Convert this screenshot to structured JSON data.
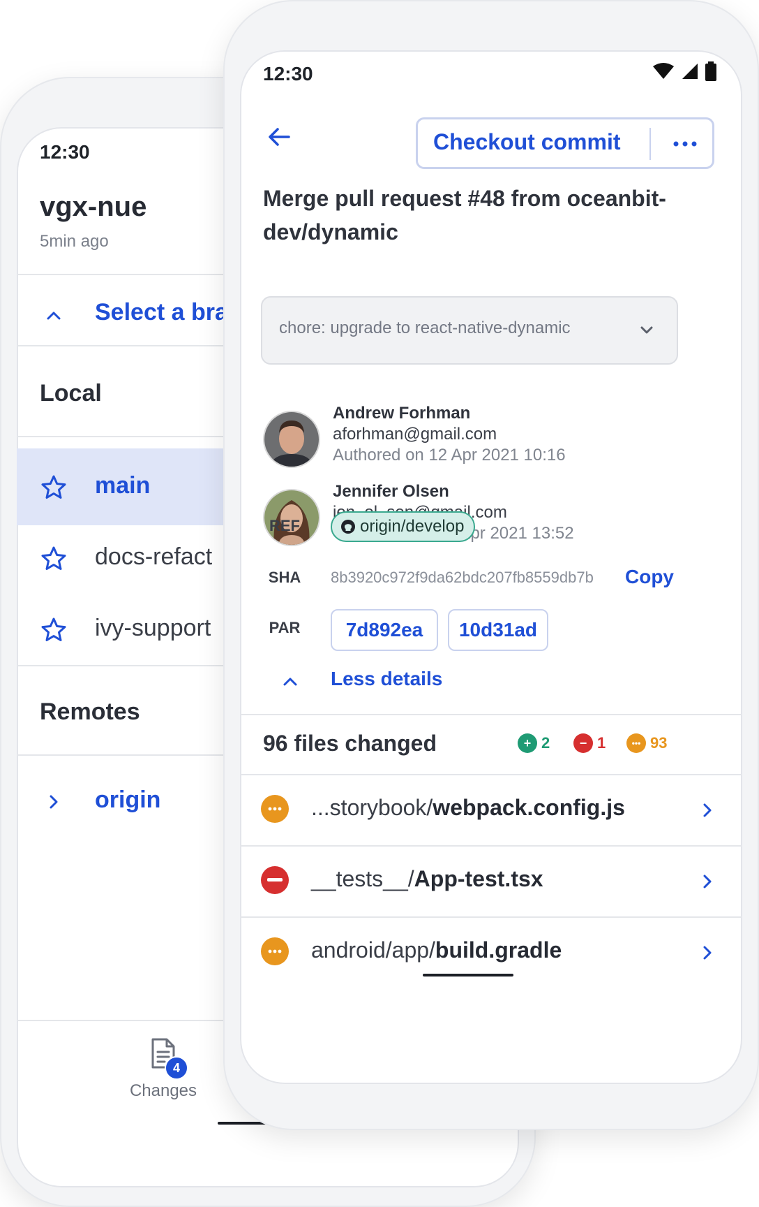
{
  "back_screen": {
    "time": "12:30",
    "repo_name": "vgx-nue",
    "repo_updated": "5min ago",
    "select_branch_label": "Select a bra",
    "local_title": "Local",
    "branches": [
      {
        "name": "main",
        "selected": true
      },
      {
        "name": "docs-refact",
        "selected": false
      },
      {
        "name": "ivy-support",
        "selected": false
      }
    ],
    "remotes_title": "Remotes",
    "remotes": [
      {
        "name": "origin"
      }
    ],
    "tab": {
      "label": "Changes",
      "badge": "4"
    }
  },
  "front_screen": {
    "time": "12:30",
    "checkout_label": "Checkout commit",
    "commit_title": "Merge pull request #48 from oceanbit-dev/dynamic",
    "commit_message_selected": "chore: upgrade to react-native-dynamic",
    "author": {
      "name": "Andrew Forhman",
      "email": "aforhman@gmail.com",
      "date": "Authored on 12 Apr 2021 10:16"
    },
    "committer": {
      "name": "Jennifer Olsen",
      "email": "jen_ol_sen@gmail.com",
      "date": "Commited on 16 Apr 2021 13:52"
    },
    "ref_label": "REF",
    "ref_value": "origin/develop",
    "sha_label": "SHA",
    "sha_value": "8b3920c972f9da62bdc207fb8559db7b",
    "copy_label": "Copy",
    "par_label": "PAR",
    "parents": [
      "7d892ea",
      "10d31ad"
    ],
    "less_details_label": "Less details",
    "files_changed_label": "96 files changed",
    "stats": {
      "added": "2",
      "removed": "1",
      "modified": "93"
    },
    "files": [
      {
        "dir": "...storybook/",
        "name": "webpack.config.js",
        "status": "modified"
      },
      {
        "dir": "__tests__/",
        "name": "App-test.tsx",
        "status": "removed"
      },
      {
        "dir": "android/app/",
        "name": "build.gradle",
        "status": "modified"
      }
    ]
  },
  "colors": {
    "accent": "#1f4fd6",
    "selected_bg": "#dfe5f8",
    "added": "#1f9b74",
    "removed": "#d62f2f",
    "modified": "#e8961e"
  }
}
